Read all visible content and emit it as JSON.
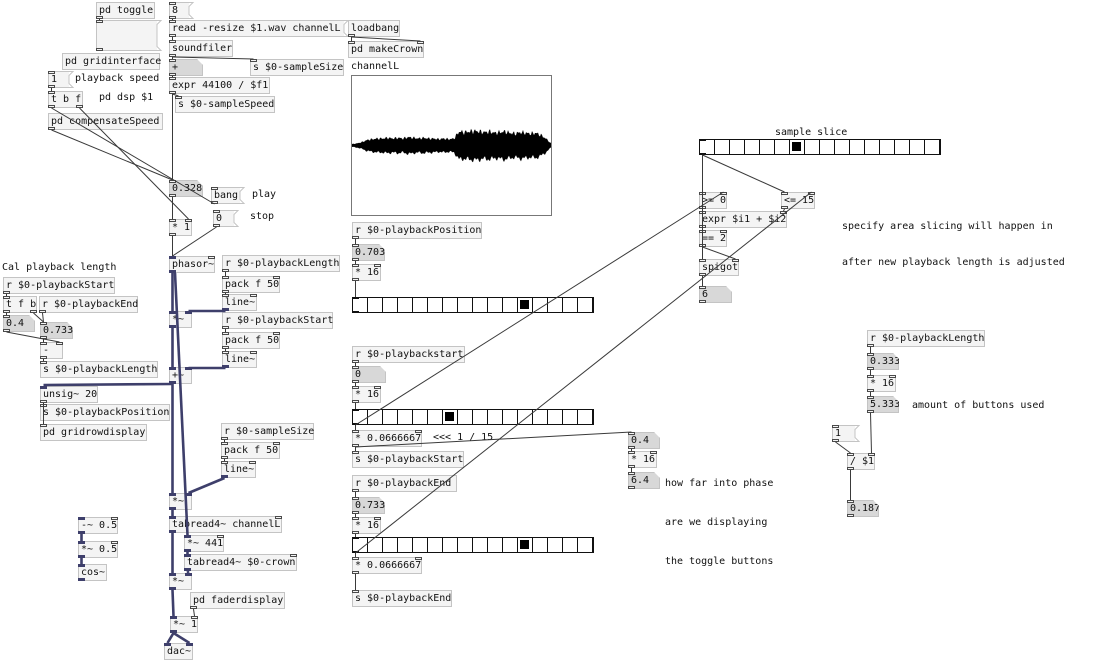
{
  "dsp": {
    "pd_toggle": "pd toggle",
    "dsp_msg": [
      ";",
      "pd dsp $1"
    ],
    "gridinterface": "pd gridinterface"
  },
  "speed": {
    "init_msg": "1",
    "label": "playback speed",
    "trigger": "t b f",
    "compensate": "pd compensateSpeed",
    "speed_value": "0.328",
    "multiply": "* 1"
  },
  "loader": {
    "index_msg": "8",
    "read_msg": "read -resize $1.wav channelL",
    "soundfiler": "soundfiler",
    "size_value": "+",
    "send_size": "s $0-sampleSize",
    "expr": "expr 44100 / $f1",
    "send_speed": "s $0-sampleSpeed",
    "loadbang": "loadbang",
    "make_crown": "pd makeCrown"
  },
  "array": {
    "name": "channelL",
    "range": [
      -1,
      1
    ],
    "envelope": [
      0.02,
      0.03,
      0.05,
      0.08,
      0.09,
      0.1,
      0.1,
      0.11,
      0.1,
      0.11,
      0.1,
      0.12,
      0.11,
      0.1,
      0.11,
      0.1,
      0.1,
      0.09,
      0.1,
      0.09,
      0.1,
      0.2,
      0.19,
      0.2,
      0.21,
      0.2,
      0.19,
      0.2,
      0.18,
      0.19,
      0.2,
      0.18,
      0.17,
      0.19,
      0.18,
      0.17,
      0.18,
      0.15,
      0.1,
      0.03
    ]
  },
  "transport": {
    "bang_msg": "bang",
    "play_label": "play",
    "stop_msg": "0",
    "stop_label": "stop",
    "phasor": "phasor~"
  },
  "length_ramp": {
    "receive": "r $0-playbackLength",
    "pack": "pack f 50",
    "line": "line~",
    "mul": "*~"
  },
  "start_ramp": {
    "receive": "r $0-playbackStart",
    "pack": "pack f 50",
    "line": "line~",
    "add": "+~"
  },
  "calc_length": {
    "label": "Cal playback length",
    "receive_start": "r $0-playbackStart",
    "trigger": "t f b",
    "receive_end": "r $0-playbackEnd",
    "start_value": "0.4",
    "end_value": "0.733",
    "subtract": "-",
    "send_length": "s $0-playbackLength",
    "unsig": "unsig~ 20",
    "send_position": "s $0-playbackPosition",
    "gridrowdisplay": "pd gridrowdisplay"
  },
  "sample_ramp": {
    "receive": "r $0-sampleSize",
    "pack": "pack f 50",
    "line": "line~",
    "mul": "*~"
  },
  "output": {
    "tabread_channel": "tabread4~ channelL",
    "mul_441": "*~ 441",
    "tabread_crown": "tabread4~ $0-crown",
    "mul": "*~",
    "faderdisplay": "pd faderdisplay",
    "mul_1": "*~ 1",
    "dac": "dac~"
  },
  "window_fn": {
    "sub": "-~ 0.5",
    "mul": "*~ 0.5",
    "cos": "cos~"
  },
  "position_display": {
    "receive": "r $0-playbackPosition",
    "value": "0.703",
    "mul": "* 16",
    "radio": {
      "cells": 16,
      "selected": 11
    }
  },
  "start_select": {
    "receive": "r $0-playbackstart",
    "value": "0",
    "mul": "* 16",
    "radio": {
      "cells": 16,
      "selected": 6
    },
    "scale": "* 0.0666667",
    "note": "<<< 1 / 15",
    "send": "s $0-playbackStart"
  },
  "end_select": {
    "receive": "r $0-playbackEnd",
    "value": "0.733",
    "mul": "* 16",
    "radio": {
      "cells": 16,
      "selected": 11
    },
    "scale": "* 0.0666667",
    "send": "s $0-playbackEnd"
  },
  "phase_display": {
    "value": "0.4",
    "mul": "* 16",
    "result": "6.4",
    "note": [
      "how far into phase",
      "are we displaying",
      "the toggle buttons"
    ]
  },
  "slice": {
    "label": "sample slice",
    "radio": {
      "cells": 16,
      "selected": 6
    },
    "gte": ">= 0",
    "lte": "<= 15",
    "expr": "expr $i1 + $i2",
    "eq": "== 2",
    "spigot": "spigot",
    "value": "6",
    "note": [
      "specify area slicing will happen in",
      "after new playback length is adjusted"
    ]
  },
  "buttons_used": {
    "receive": "r $0-playbackLength",
    "value": "0.333",
    "mul": "* 16",
    "result": "5.333",
    "note": "amount of buttons used",
    "msg": "1",
    "divide": "/ $1",
    "ratio": "0.187"
  }
}
